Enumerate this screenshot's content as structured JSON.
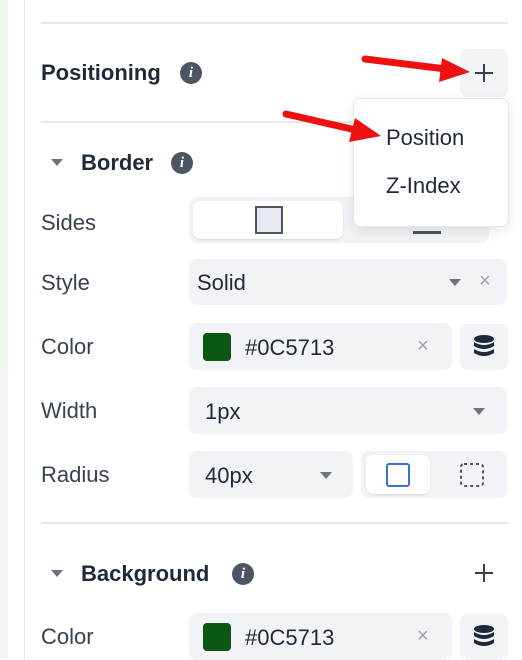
{
  "positioning": {
    "title": "Positioning",
    "add_label": "+"
  },
  "dropdown": {
    "items": [
      "Position",
      "Z-Index"
    ]
  },
  "border": {
    "title": "Border",
    "sides_label": "Sides",
    "style_label": "Style",
    "style_value": "Solid",
    "color_label": "Color",
    "color_value": "#0C5713",
    "width_label": "Width",
    "width_value": "1px",
    "radius_label": "Radius",
    "radius_value": "40px"
  },
  "background": {
    "title": "Background",
    "color_label": "Color",
    "color_value": "#0C5713"
  },
  "colors": {
    "swatch": "#0C5713",
    "annotation_arrow": "#ee1111"
  }
}
